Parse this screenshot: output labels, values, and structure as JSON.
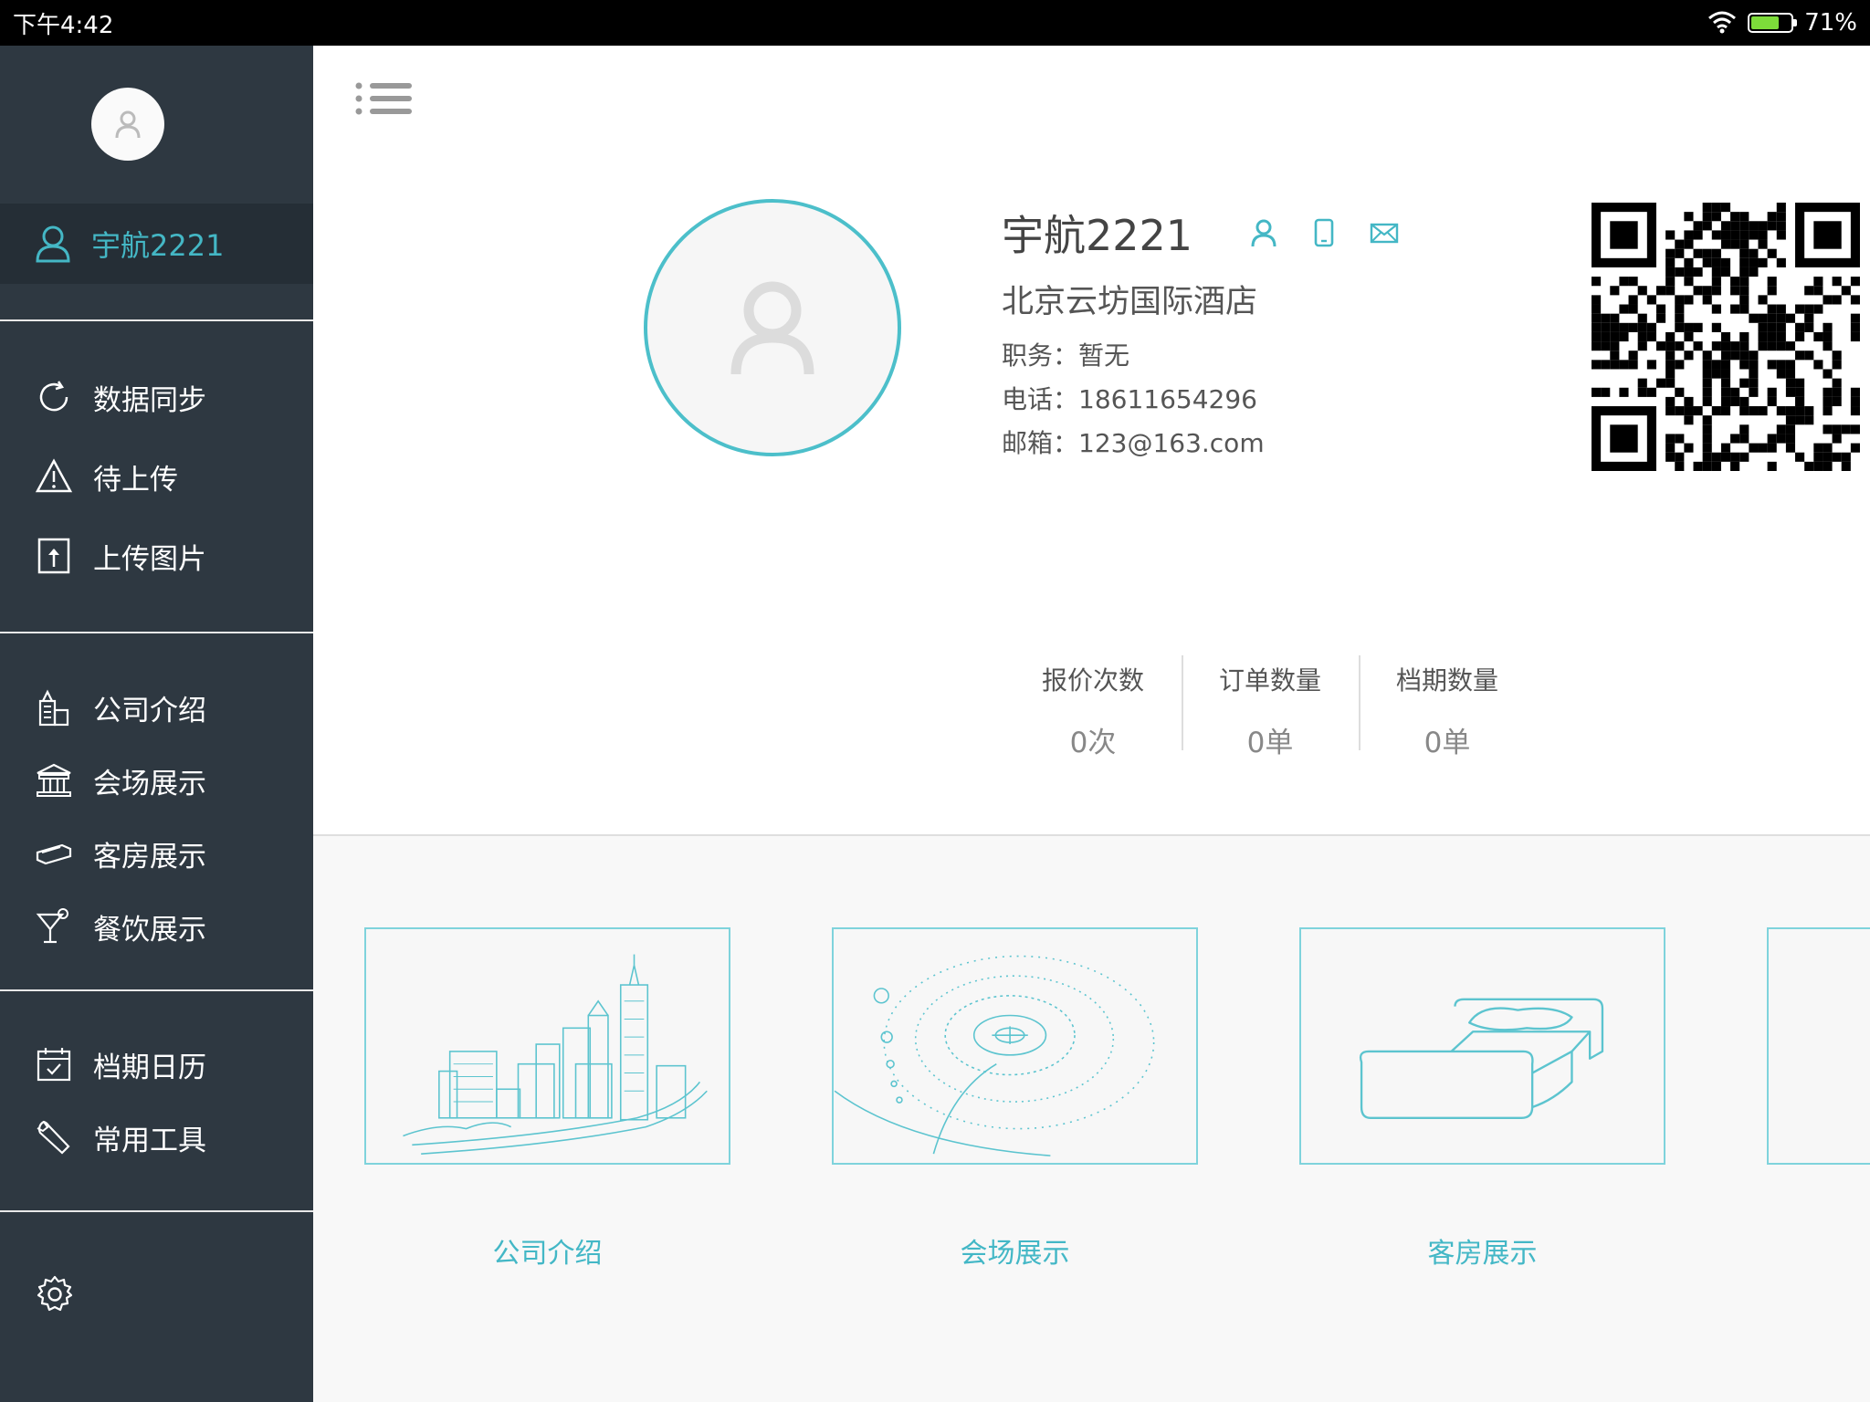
{
  "status": {
    "time": "下午4:42",
    "battery": "71%",
    "battery_level": 0.71
  },
  "sidebar": {
    "user_name": "宇航2221",
    "items": [
      {
        "label": "数据同步",
        "icon": "sync-icon"
      },
      {
        "label": "待上传",
        "icon": "warning-icon"
      },
      {
        "label": "上传图片",
        "icon": "upload-image-icon"
      },
      {
        "label": "公司介绍",
        "icon": "building-icon"
      },
      {
        "label": "会场展示",
        "icon": "venue-icon"
      },
      {
        "label": "客房展示",
        "icon": "bed-icon"
      },
      {
        "label": "餐饮展示",
        "icon": "cocktail-icon"
      },
      {
        "label": "档期日历",
        "icon": "calendar-icon"
      },
      {
        "label": "常用工具",
        "icon": "wrench-icon"
      }
    ]
  },
  "profile": {
    "name": "宇航2221",
    "hotel": "北京云坊国际酒店",
    "position": "职务：暂无",
    "phone": "电话：18611654296",
    "email": "邮箱：123@163.com"
  },
  "stats": [
    {
      "label": "报价次数",
      "value": "0次"
    },
    {
      "label": "订单数量",
      "value": "0单"
    },
    {
      "label": "档期数量",
      "value": "0单"
    }
  ],
  "cards": [
    {
      "label": "公司介绍"
    },
    {
      "label": "会场展示"
    },
    {
      "label": "客房展示"
    }
  ],
  "colors": {
    "accent": "#44b7c5",
    "sidebar_bg": "#2e3841",
    "sidebar_active": "#252e36"
  }
}
